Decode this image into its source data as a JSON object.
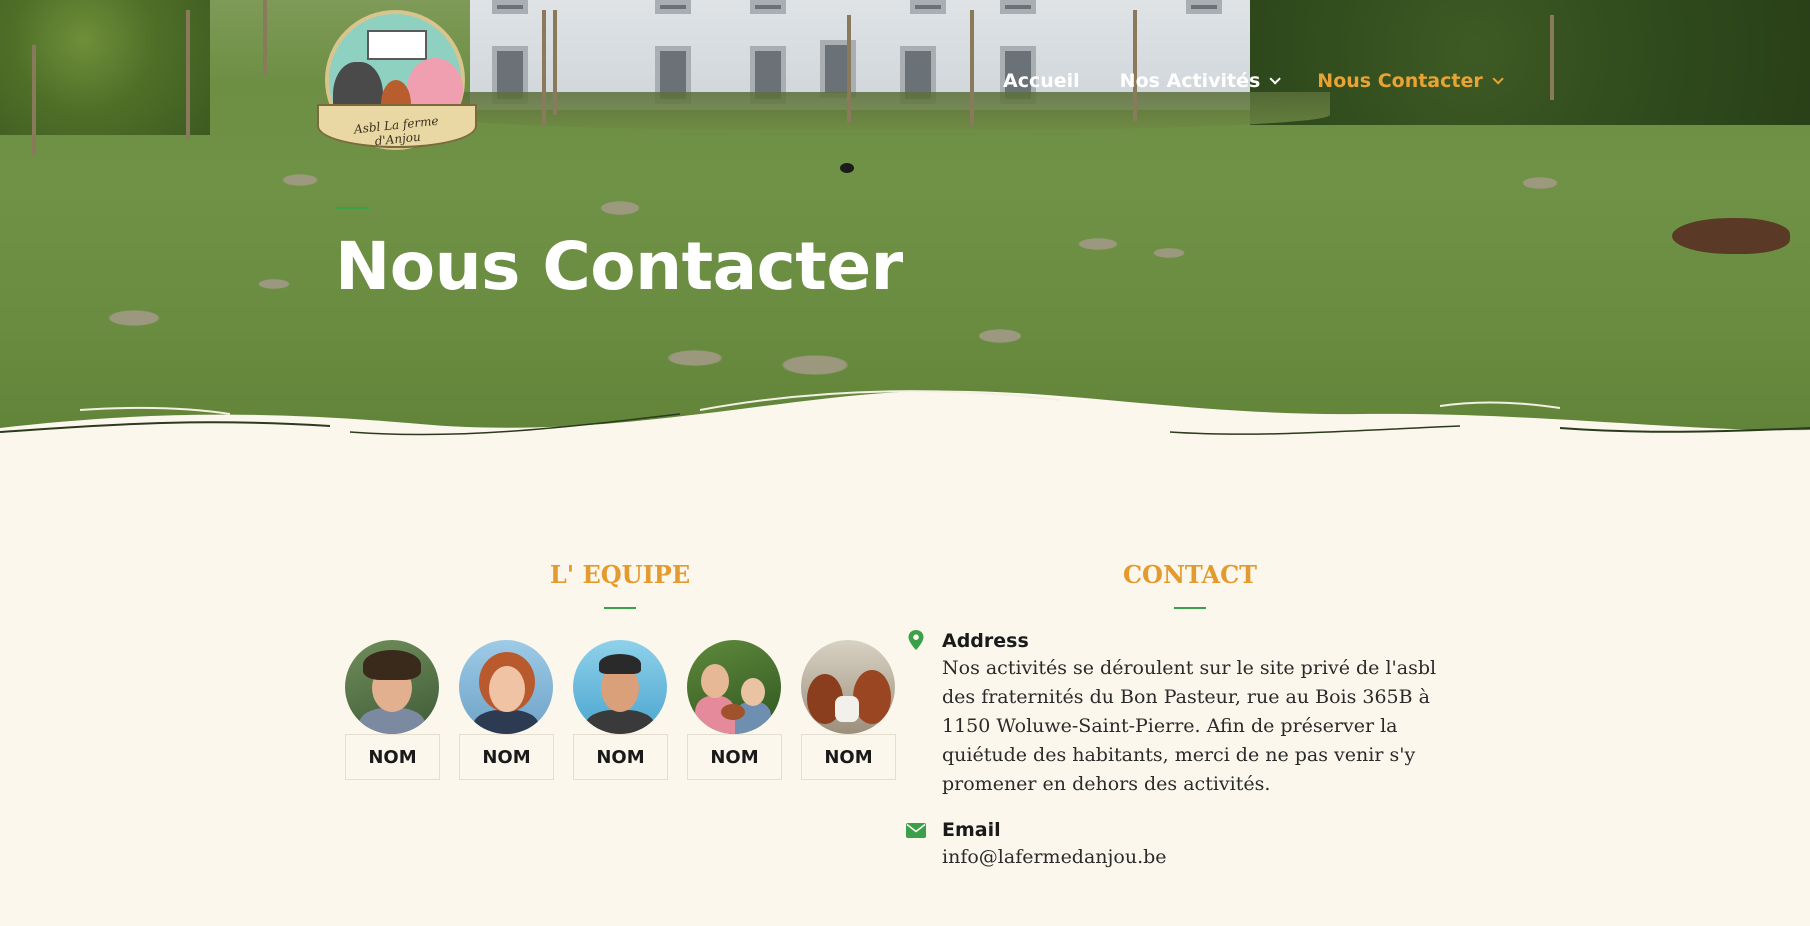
{
  "site": {
    "logo_alt": "Asbl La ferme d'Anjou"
  },
  "nav": {
    "items": [
      {
        "label": "Accueil",
        "dropdown": false,
        "active": false
      },
      {
        "label": "Nos Activités",
        "dropdown": true,
        "active": false
      },
      {
        "label": "Nous Contacter",
        "dropdown": true,
        "active": true
      }
    ],
    "active_color": "#e8a334"
  },
  "hero": {
    "title": "Nous Contacter"
  },
  "team": {
    "heading": "L' EQUIPE",
    "members": [
      {
        "name": "NOM"
      },
      {
        "name": "NOM"
      },
      {
        "name": "NOM"
      },
      {
        "name": "NOM"
      },
      {
        "name": "NOM"
      }
    ]
  },
  "contact": {
    "heading": "CONTACT",
    "address_label": "Address",
    "address_text": "Nos activités se déroulent sur le site privé de l'asbl des fraternités du Bon Pasteur, rue au Bois 365B à 1150 Woluwe-Saint-Pierre. Afin de préserver la quiétude des habitants, merci de ne pas venir s'y promener en dehors des activités.",
    "email_label": "Email",
    "email_text": "info@lafermedanjou.be"
  },
  "colors": {
    "accent_orange": "#e39a2e",
    "accent_green": "#3aa14a",
    "background": "#fbf7ec"
  },
  "icons": {
    "address": "map-marker-icon",
    "email": "envelope-icon"
  }
}
